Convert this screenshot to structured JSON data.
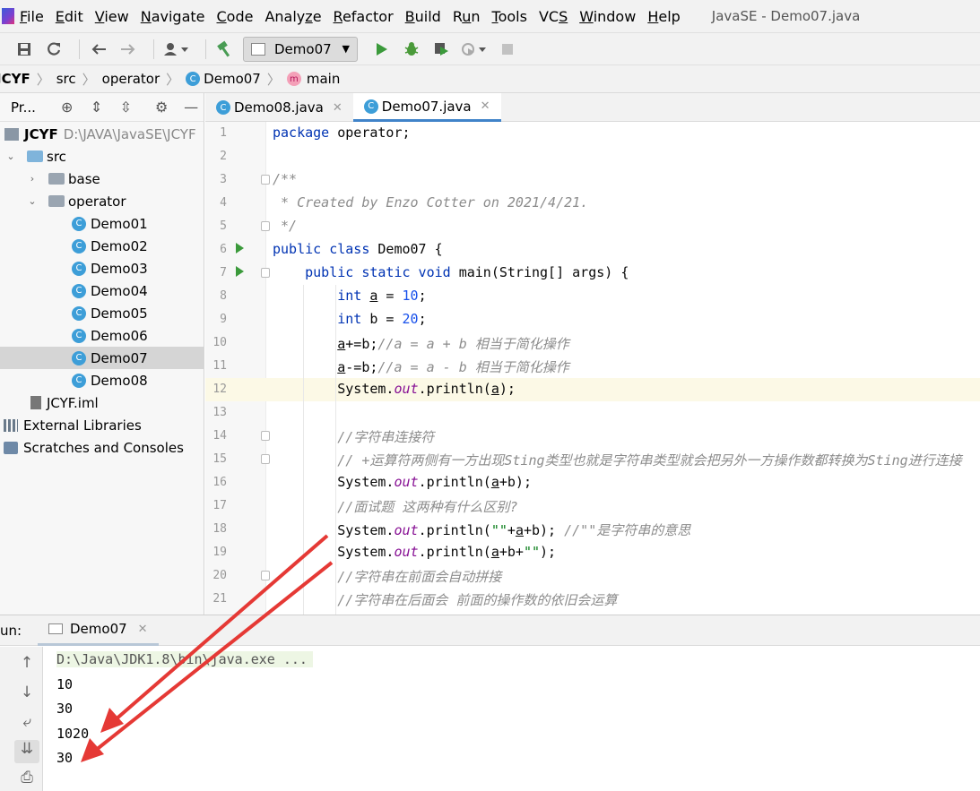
{
  "menu": {
    "items": [
      {
        "mnemonic": "F",
        "rest": "ile"
      },
      {
        "mnemonic": "E",
        "rest": "dit"
      },
      {
        "mnemonic": "V",
        "rest": "iew"
      },
      {
        "mnemonic": "N",
        "rest": "avigate"
      },
      {
        "mnemonic": "C",
        "rest": "ode"
      },
      {
        "pre": "Analy",
        "mnemonic": "z",
        "rest": "e"
      },
      {
        "mnemonic": "R",
        "rest": "efactor"
      },
      {
        "mnemonic": "B",
        "rest": "uild"
      },
      {
        "pre": "R",
        "mnemonic": "u",
        "rest": "n"
      },
      {
        "mnemonic": "T",
        "rest": "ools"
      },
      {
        "pre": "VC",
        "mnemonic": "S",
        "rest": ""
      },
      {
        "mnemonic": "W",
        "rest": "indow"
      },
      {
        "mnemonic": "H",
        "rest": "elp"
      }
    ],
    "window_title": "JavaSE - Demo07.java"
  },
  "toolbar": {
    "run_config": "Demo07",
    "colors": {
      "run": "#3b9a3b",
      "debug": "#4a9a3a",
      "build": "#499c54"
    }
  },
  "navbar": {
    "crumbs": [
      "JCYF",
      "src",
      "operator",
      "Demo07",
      "main"
    ]
  },
  "project": {
    "header_title": "Pr...",
    "root_name": "JCYF",
    "root_path": "D:\\JAVA\\JavaSE\\JCYF",
    "src": "src",
    "base": "base",
    "operator": "operator",
    "classes": [
      "Demo01",
      "Demo02",
      "Demo03",
      "Demo04",
      "Demo05",
      "Demo06",
      "Demo07",
      "Demo08"
    ],
    "selected": "Demo07",
    "iml": "JCYF.iml",
    "external_libraries": "External Libraries",
    "scratches": "Scratches and Consoles"
  },
  "editor": {
    "tabs": [
      {
        "label": "Demo08.java",
        "active": false
      },
      {
        "label": "Demo07.java",
        "active": true
      }
    ],
    "current_line": 12,
    "line_numbers": [
      "1",
      "2",
      "3",
      "4",
      "5",
      "6",
      "7",
      "8",
      "9",
      "10",
      "11",
      "12",
      "13",
      "14",
      "15",
      "16",
      "17",
      "18",
      "19",
      "20",
      "21"
    ]
  },
  "run_panel": {
    "label": "un:",
    "tab": "Demo07",
    "command": "D:\\Java\\JDK1.8\\bin\\java.exe ...",
    "output": [
      "10",
      "30",
      "1020",
      "30"
    ],
    "arrow_color": "#e53935"
  }
}
